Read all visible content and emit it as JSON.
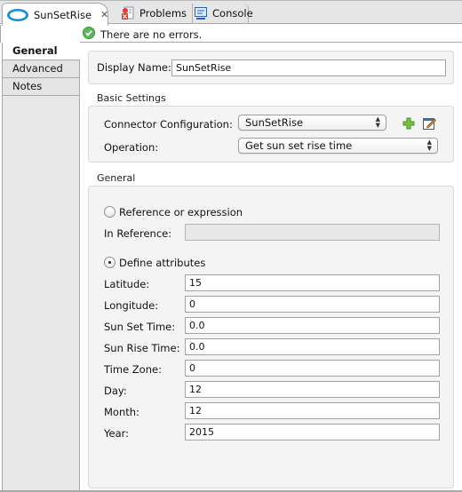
{
  "tabs": [
    {
      "label": "SunSetRise",
      "icon": "cloud-icon",
      "active": true,
      "close_glyph": "✕"
    },
    {
      "label": "Problems",
      "icon": "problems-icon",
      "active": false
    },
    {
      "label": "Console",
      "icon": "console-icon",
      "active": false
    }
  ],
  "status": {
    "message": "There are no errors.",
    "icon": "check-circle-icon",
    "color": "#4caf50"
  },
  "sidebar": {
    "items": [
      {
        "label": "General",
        "active": true
      },
      {
        "label": "Advanced",
        "active": false
      },
      {
        "label": "Notes",
        "active": false
      }
    ]
  },
  "display": {
    "label": "Display Name:",
    "value": "SunSetRise"
  },
  "basic_settings": {
    "title": "Basic Settings",
    "connector_label": "Connector Configuration:",
    "connector_value": "SunSetRise",
    "add_icon": "plus-icon",
    "edit_icon": "edit-icon",
    "operation_label": "Operation:",
    "operation_value": "Get sun set rise time"
  },
  "general": {
    "title": "General",
    "radio_reference": {
      "label": "Reference or expression",
      "checked": false
    },
    "in_reference": {
      "label": "In Reference:",
      "value": ""
    },
    "radio_define": {
      "label": "Define attributes",
      "checked": true
    },
    "fields": [
      {
        "label": "Latitude:",
        "value": "15"
      },
      {
        "label": "Longitude:",
        "value": "0"
      },
      {
        "label": "Sun Set Time:",
        "value": "0.0"
      },
      {
        "label": "Sun Rise Time:",
        "value": "0.0"
      },
      {
        "label": "Time Zone:",
        "value": "0"
      },
      {
        "label": "Day:",
        "value": "12"
      },
      {
        "label": "Month:",
        "value": "12"
      },
      {
        "label": "Year:",
        "value": "2015"
      }
    ]
  }
}
